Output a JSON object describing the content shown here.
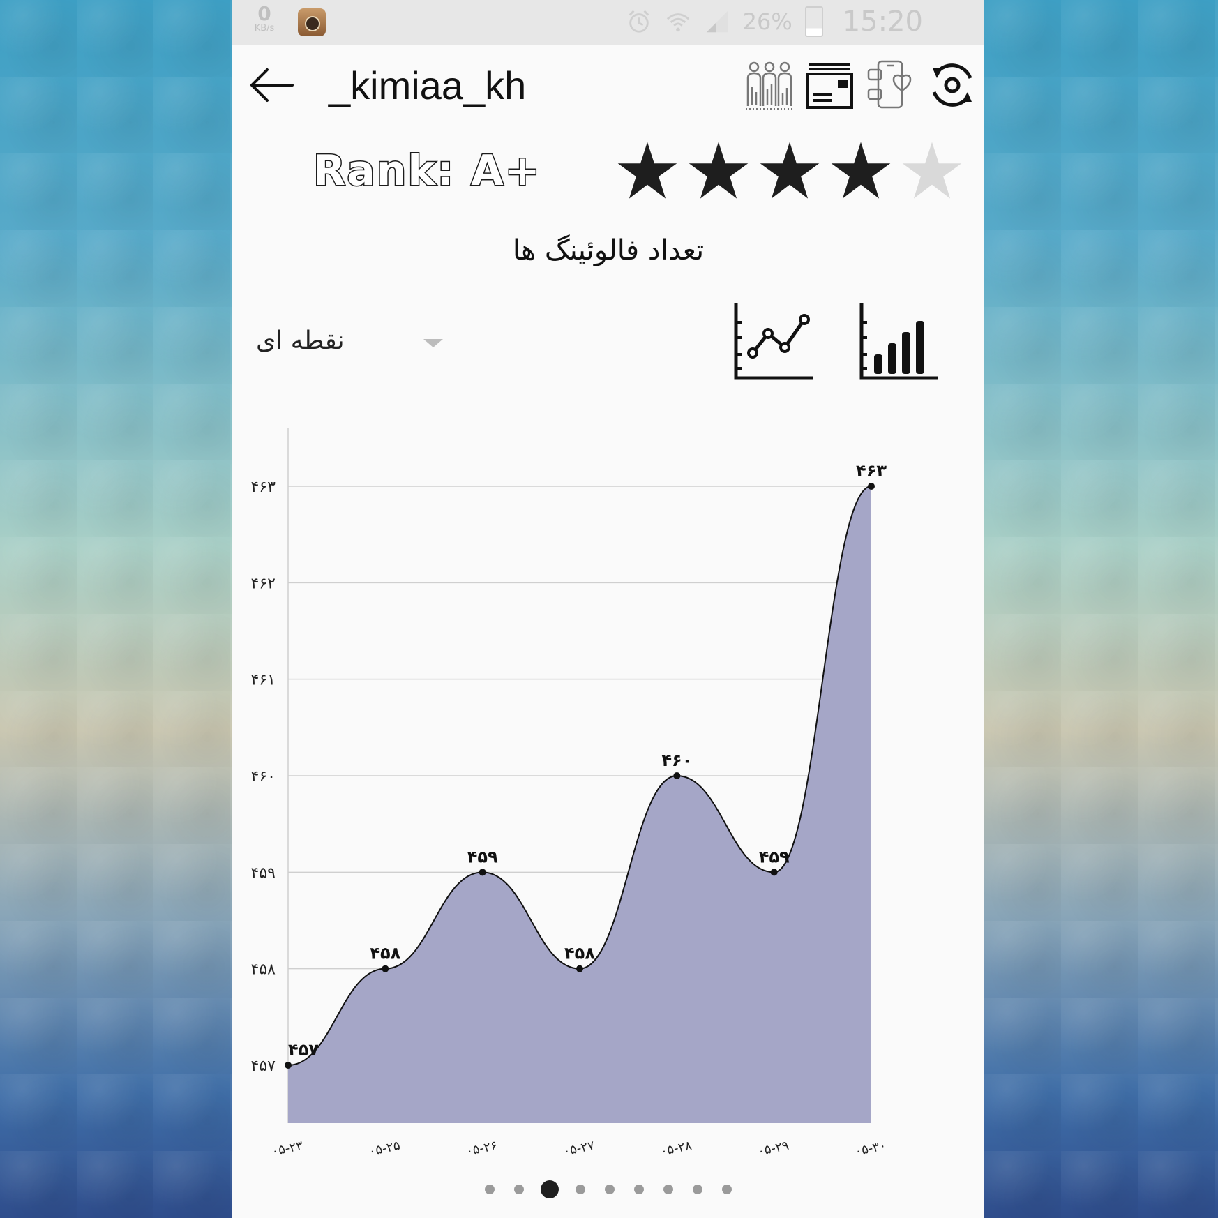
{
  "status_bar": {
    "net_speed_value": "0",
    "net_speed_unit": "KB/s",
    "battery_percent": "26%",
    "time": "15:20"
  },
  "header": {
    "username": "_kimiaa_kh"
  },
  "profile": {
    "rank_label": "Rank: A+",
    "stars_total": 5,
    "stars_filled": 4
  },
  "chart_section": {
    "title": "تعداد فالوئینگ ها",
    "chart_style_dropdown": "نقطه ای",
    "pager_total": 9,
    "pager_active_index": 2
  },
  "colors": {
    "area_fill": "#a5a6c7",
    "line": "#111111",
    "grid": "#cfcfcf",
    "star_filled": "#1e1e1e",
    "star_empty": "#d9d9d9"
  },
  "chart_data": {
    "type": "area",
    "title": "تعداد فالوئینگ ها",
    "x": [
      "۰۵-۲۳",
      "۰۵-۲۵",
      "۰۵-۲۶",
      "۰۵-۲۷",
      "۰۵-۲۸",
      "۰۵-۲۹",
      "۰۵-۳۰"
    ],
    "values": [
      457,
      458,
      459,
      458,
      460,
      459,
      463
    ],
    "value_labels": [
      "۴۵۷",
      "۴۵۸",
      "۴۵۹",
      "۴۵۸",
      "۴۶۰",
      "۴۵۹",
      "۴۶۳"
    ],
    "yticks": [
      457,
      458,
      459,
      460,
      461,
      462,
      463
    ],
    "ytick_labels": [
      "۴۵۷",
      "۴۵۸",
      "۴۵۹",
      "۴۶۰",
      "۴۶۱",
      "۴۶۲",
      "۴۶۳"
    ],
    "ylim": [
      456.4,
      463.6
    ],
    "grid": true,
    "smooth": true,
    "markers": true
  }
}
